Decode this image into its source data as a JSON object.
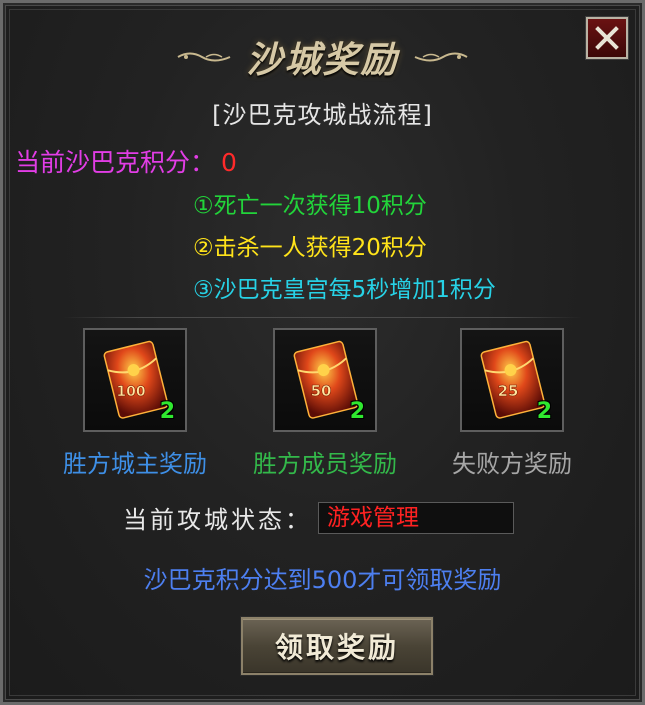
{
  "window": {
    "title": "沙城奖励",
    "subtitle": "[沙巴克攻城战流程]",
    "close_icon": "close-icon"
  },
  "score": {
    "label": "当前沙巴克积分：",
    "value": "0"
  },
  "rules": [
    {
      "text": "①死亡一次获得10积分",
      "color": "#22d43a"
    },
    {
      "text": "②击杀一人获得20积分",
      "color": "#ffe31a"
    },
    {
      "text": "③沙巴克皇宫每5秒增加1积分",
      "color": "#27d2e6"
    }
  ],
  "rewards": [
    {
      "label": "胜方城主奖励",
      "item_icon": "red-envelope-icon",
      "badge": "100",
      "count": "2",
      "color": "#3e8fe6"
    },
    {
      "label": "胜方成员奖励",
      "item_icon": "red-envelope-icon",
      "badge": "50",
      "count": "2",
      "color": "#33b84a"
    },
    {
      "label": "失败方奖励",
      "item_icon": "red-envelope-icon",
      "badge": "25",
      "count": "2",
      "color": "#a6a6a6"
    }
  ],
  "status": {
    "label": "当前攻城状态：",
    "value": "游戏管理"
  },
  "notice": "沙巴克积分达到500才可领取奖励",
  "claim_button": {
    "label": "领取奖励"
  }
}
